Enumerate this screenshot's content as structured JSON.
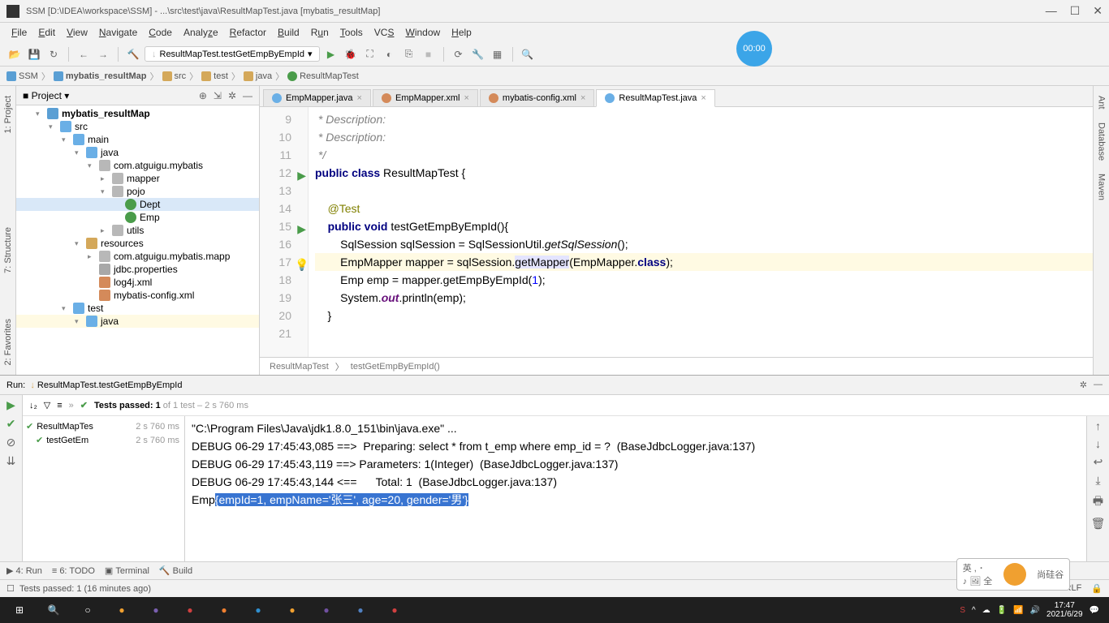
{
  "window": {
    "title": "SSM [D:\\IDEA\\workspace\\SSM] - ...\\src\\test\\java\\ResultMapTest.java [mybatis_resultMap]"
  },
  "menu": {
    "file": "File",
    "edit": "Edit",
    "view": "View",
    "navigate": "Navigate",
    "code": "Code",
    "analyze": "Analyze",
    "refactor": "Refactor",
    "build": "Build",
    "run": "Run",
    "tools": "Tools",
    "vcs": "VCS",
    "window": "Window",
    "help": "Help"
  },
  "toolbar": {
    "run_config": "ResultMapTest.testGetEmpByEmpId"
  },
  "timer": "00:00",
  "breadcrumb": {
    "items": [
      "SSM",
      "mybatis_resultMap",
      "src",
      "test",
      "java",
      "ResultMapTest"
    ]
  },
  "project": {
    "title": "Project",
    "tree": [
      {
        "ind": 1,
        "arrow": "▾",
        "icon": "module",
        "label": "mybatis_resultMap",
        "bold": true
      },
      {
        "ind": 2,
        "arrow": "▾",
        "icon": "folder-blue",
        "label": "src"
      },
      {
        "ind": 3,
        "arrow": "▾",
        "icon": "folder-blue",
        "label": "main"
      },
      {
        "ind": 4,
        "arrow": "▾",
        "icon": "folder-blue",
        "label": "java"
      },
      {
        "ind": 5,
        "arrow": "▾",
        "icon": "package",
        "label": "com.atguigu.mybatis"
      },
      {
        "ind": 6,
        "arrow": "▸",
        "icon": "package",
        "label": "mapper"
      },
      {
        "ind": 6,
        "arrow": "▾",
        "icon": "package",
        "label": "pojo"
      },
      {
        "ind": 7,
        "arrow": "",
        "icon": "class",
        "label": "Dept",
        "selected": true
      },
      {
        "ind": 7,
        "arrow": "",
        "icon": "class",
        "label": "Emp"
      },
      {
        "ind": 6,
        "arrow": "▸",
        "icon": "package",
        "label": "utils"
      },
      {
        "ind": 4,
        "arrow": "▾",
        "icon": "folder",
        "label": "resources"
      },
      {
        "ind": 5,
        "arrow": "▸",
        "icon": "package",
        "label": "com.atguigu.mybatis.mapp"
      },
      {
        "ind": 5,
        "arrow": "",
        "icon": "file",
        "label": "jdbc.properties"
      },
      {
        "ind": 5,
        "arrow": "",
        "icon": "xml",
        "label": "log4j.xml"
      },
      {
        "ind": 5,
        "arrow": "",
        "icon": "xml",
        "label": "mybatis-config.xml"
      },
      {
        "ind": 3,
        "arrow": "▾",
        "icon": "folder-blue",
        "label": "test"
      },
      {
        "ind": 4,
        "arrow": "▾",
        "icon": "folder-blue",
        "label": "java",
        "hl": true
      }
    ]
  },
  "editor": {
    "tabs": [
      {
        "label": "EmpMapper.java",
        "icon": "java"
      },
      {
        "label": "EmpMapper.xml",
        "icon": "xml"
      },
      {
        "label": "mybatis-config.xml",
        "icon": "xml"
      },
      {
        "label": "ResultMapTest.java",
        "icon": "java",
        "active": true
      }
    ],
    "lines": [
      {
        "n": 9,
        "html": " * Description:",
        "cls": "comment"
      },
      {
        "n": 10,
        "html": " * Description:",
        "cls": "comment"
      },
      {
        "n": 11,
        "html": " */",
        "cls": "comment"
      },
      {
        "n": 12,
        "html": "<span class='kw'>public class</span> ResultMapTest {",
        "run": true
      },
      {
        "n": 13,
        "html": ""
      },
      {
        "n": 14,
        "html": "    <span class='anno'>@Test</span>"
      },
      {
        "n": 15,
        "html": "    <span class='kw'>public void</span> testGetEmpByEmpId(){",
        "run": true
      },
      {
        "n": 16,
        "html": "        SqlSession sqlSession = SqlSessionUtil.<span class='method-static'>getSqlSession</span>();"
      },
      {
        "n": 17,
        "html": "        EmpMapper mapper = sqlSession.<span class='hl-usage'>getMapper</span>(EmpMapper.<span class='kw'>class</span>);",
        "bulb": true,
        "hl": true
      },
      {
        "n": 18,
        "html": "        Emp emp = mapper.getEmpByEmpId(<span class='num'>1</span>);"
      },
      {
        "n": 19,
        "html": "        System.<span class='field-static'>out</span>.println(emp);"
      },
      {
        "n": 20,
        "html": "    }"
      },
      {
        "n": 21,
        "html": ""
      }
    ],
    "breadcrumb": [
      "ResultMapTest",
      "testGetEmpByEmpId()"
    ]
  },
  "run": {
    "title": "ResultMapTest.testGetEmpByEmpId",
    "tests_label": "Tests passed: 1",
    "tests_suffix": " of 1 test – 2 s 760 ms",
    "tree": [
      {
        "label": "ResultMapTes",
        "time": "2 s 760 ms"
      },
      {
        "label": "testGetEm",
        "time": "2 s 760 ms"
      }
    ],
    "console": [
      "\"C:\\Program Files\\Java\\jdk1.8.0_151\\bin\\java.exe\" ...",
      "DEBUG 06-29 17:45:43,085 ==>  Preparing: select * from t_emp where emp_id = ?  (BaseJdbcLogger.java:137)",
      "DEBUG 06-29 17:45:43,119 ==> Parameters: 1(Integer)  (BaseJdbcLogger.java:137)",
      "DEBUG 06-29 17:45:43,144 <==      Total: 1  (BaseJdbcLogger.java:137)",
      "Emp"
    ],
    "console_selected": "{empId=1, empName='张三', age=20, gender='男'}"
  },
  "bottom_tabs": {
    "run": "4: Run",
    "todo": "6: TODO",
    "terminal": "Terminal",
    "build": "Build"
  },
  "status": {
    "left": "Tests passed: 1 (16 minutes ago)",
    "time": "17:47",
    "encoding": "CRLF"
  },
  "left_vtabs": {
    "project": "1: Project",
    "structure": "7: Structure",
    "favorites": "2: Favorites"
  },
  "right_vtabs": {
    "ant": "Ant",
    "database": "Database",
    "maven": "Maven"
  },
  "ime": {
    "text": "英 , ･\n♪ 🖼 全",
    "brand": "尚硅谷"
  },
  "tray": {
    "time": "17:47\n2021/6/29"
  }
}
